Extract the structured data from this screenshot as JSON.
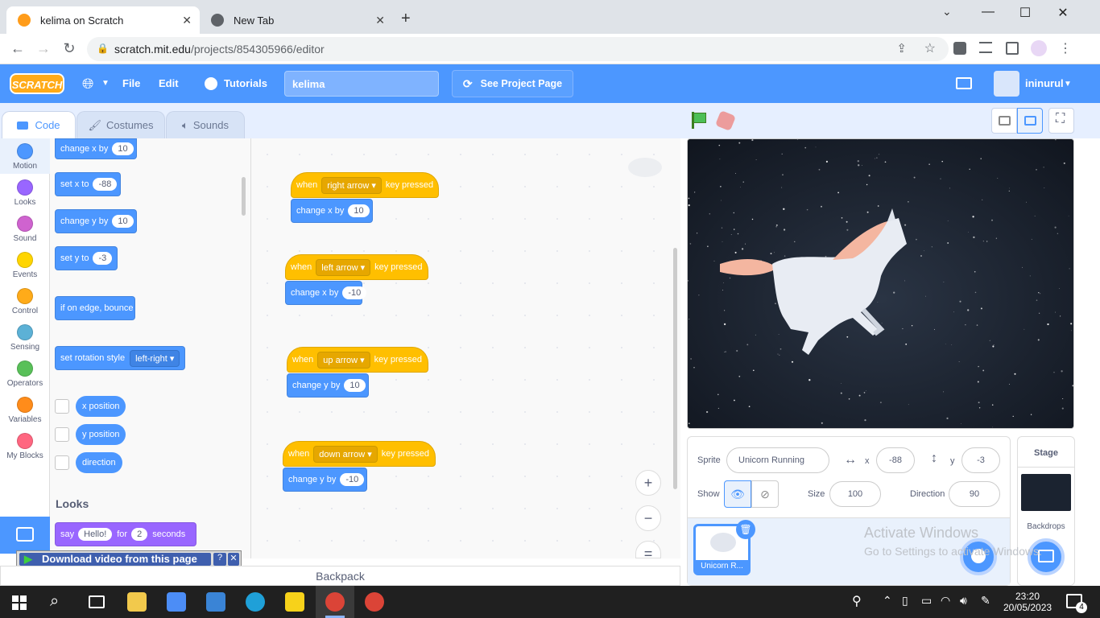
{
  "browser": {
    "tabs": [
      {
        "title": "kelima on Scratch",
        "close": "✕"
      },
      {
        "title": "New Tab",
        "close": "✕"
      }
    ],
    "new_tab": "+",
    "window_controls": {
      "minimize": "—",
      "maximize": "☐",
      "close": "✕"
    },
    "url_host": "scratch.mit.edu",
    "url_path": "/projects/854305966/editor"
  },
  "scratch": {
    "menu": {
      "logo": "SCRATCH",
      "file": "File",
      "edit": "Edit",
      "tutorials": "Tutorials",
      "project_title": "kelima",
      "see_project": "See Project Page",
      "username": "ininurul"
    },
    "editor_tabs": [
      "Code",
      "Costumes",
      "Sounds"
    ],
    "categories": [
      {
        "label": "Motion",
        "color": "#4c97ff"
      },
      {
        "label": "Looks",
        "color": "#9966ff"
      },
      {
        "label": "Sound",
        "color": "#cf63cf"
      },
      {
        "label": "Events",
        "color": "#ffd500"
      },
      {
        "label": "Control",
        "color": "#ffab19"
      },
      {
        "label": "Sensing",
        "color": "#5cb1d6"
      },
      {
        "label": "Operators",
        "color": "#59c059"
      },
      {
        "label": "Variables",
        "color": "#ff8c1a"
      },
      {
        "label": "My Blocks",
        "color": "#ff6680"
      }
    ],
    "palette": {
      "change_x": {
        "text": "change x by",
        "value": "10"
      },
      "set_x": {
        "text": "set x to",
        "value": "-88"
      },
      "change_y": {
        "text": "change y by",
        "value": "10"
      },
      "set_y": {
        "text": "set y to",
        "value": "-3"
      },
      "bounce": "if on edge, bounce",
      "rotation": {
        "text": "set rotation style",
        "value": "left-right"
      },
      "x_position": "x position",
      "y_position": "y position",
      "direction": "direction",
      "looks_heading": "Looks",
      "say": {
        "text": "say",
        "value": "Hello!",
        "for": "for",
        "secs": "2",
        "seconds": "seconds"
      }
    },
    "scripts": [
      {
        "when": "when",
        "key": "right arrow",
        "pressed": "key pressed",
        "action": "change x by",
        "value": "10"
      },
      {
        "when": "when",
        "key": "left arrow",
        "pressed": "key pressed",
        "action": "change x by",
        "value": "-10"
      },
      {
        "when": "when",
        "key": "up arrow",
        "pressed": "key pressed",
        "action": "change y by",
        "value": "10"
      },
      {
        "when": "when",
        "key": "down arrow",
        "pressed": "key pressed",
        "action": "change y by",
        "value": "-10"
      }
    ],
    "backpack": "Backpack",
    "download_bar": "Download video from this page",
    "sprite_info": {
      "sprite_label": "Sprite",
      "sprite_name": "Unicorn Running",
      "x_label": "x",
      "x": "-88",
      "y_label": "y",
      "y": "-3",
      "show_label": "Show",
      "size_label": "Size",
      "size": "100",
      "direction_label": "Direction",
      "direction": "90"
    },
    "sprite_thumb": "Unicorn R...",
    "stage_panel": {
      "title": "Stage",
      "backdrops": "Backdrops"
    },
    "watermark": {
      "title": "Activate Windows",
      "subtitle": "Go to Settings to activate Windows."
    }
  },
  "taskbar": {
    "time": "23:20",
    "date": "20/05/2023",
    "notifications": "4"
  }
}
